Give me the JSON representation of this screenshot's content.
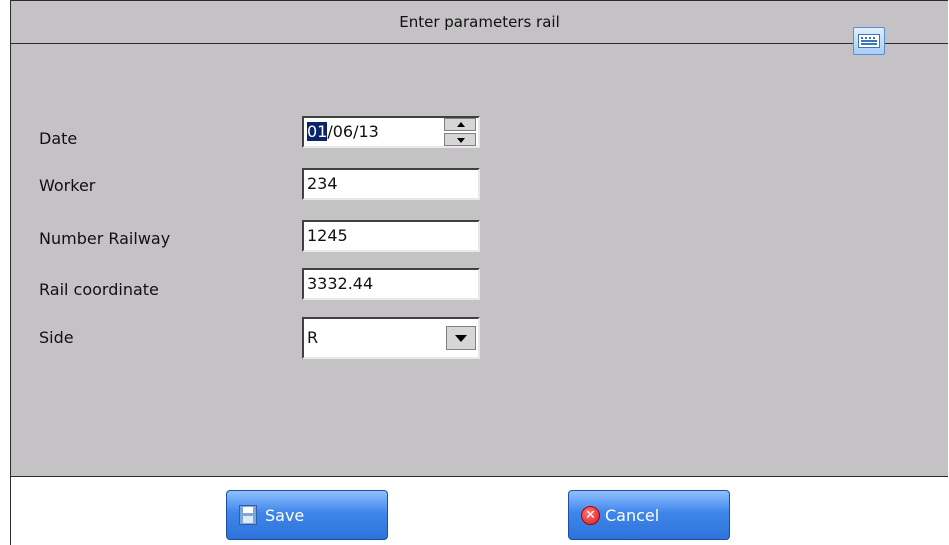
{
  "dialog": {
    "title": "Enter parameters rail",
    "keyboard_icon": "keyboard-icon"
  },
  "form": {
    "date": {
      "label": "Date",
      "day": "01",
      "rest": "/06/13"
    },
    "worker": {
      "label": "Worker",
      "value": "234"
    },
    "number_railway": {
      "label": "Number Railway",
      "value": "1245"
    },
    "rail_coordinate": {
      "label": "Rail coordinate",
      "value": "3332.44"
    },
    "side": {
      "label": "Side",
      "selected": "R"
    }
  },
  "buttons": {
    "save_label": "Save",
    "save_icon": "floppy-disk-icon",
    "cancel_label": "Cancel",
    "cancel_icon": "cancel-x-icon"
  },
  "colors": {
    "panel_background": "#c5c2c5",
    "button_blue": "#3f86ea",
    "selection": "#0a246a"
  }
}
